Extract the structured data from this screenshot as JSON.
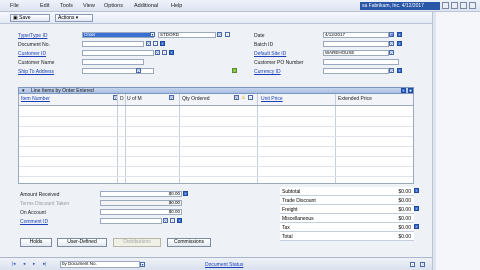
{
  "menu": [
    "File",
    "Edit",
    "Tools",
    "View",
    "Options",
    "Additional",
    "Help"
  ],
  "company": "sa  Fabrikam, Inc.  4/12/2017",
  "toolbar": {
    "save": "Save",
    "actions": "Actions"
  },
  "fields": {
    "type_type_id": "Type/Type ID",
    "type_value": "Order",
    "type_id_value": "STDORD",
    "document_no": "Document No.",
    "customer_id": "Customer ID",
    "customer_name": "Customer Name",
    "ship_to_address": "Ship To Address",
    "date": "Date",
    "date_value": "4/12/2017",
    "batch_id": "Batch ID",
    "default_site_id": "Default Site ID",
    "site_value": "WAREHOUSE",
    "customer_po": "Customer PO Number",
    "currency_id": "Currency ID"
  },
  "grid": {
    "title": "Line Items by Order Entered",
    "columns": [
      "Item Number",
      "D",
      "U of M",
      "Qty Ordered",
      "Unit Price",
      "Extended Price"
    ]
  },
  "left_totals": {
    "amount_received": "Amount Received",
    "amount_received_value": "$0.00",
    "terms_discount": "Terms Discount Taken",
    "terms_discount_value": "$0.00",
    "on_account": "On Account",
    "on_account_value": "$0.00",
    "comment_id": "Comment ID"
  },
  "totals": [
    {
      "label": "Subtotal",
      "value": "$0.00"
    },
    {
      "label": "Trade Discount",
      "value": "$0.00"
    },
    {
      "label": "Freight",
      "value": "$0.00"
    },
    {
      "label": "Miscellaneous",
      "value": "$0.00"
    },
    {
      "label": "Tax",
      "value": "$0.00"
    },
    {
      "label": "Total",
      "value": "$0.00"
    }
  ],
  "buttons": {
    "holds": "Holds",
    "user_defined": "User-Defined",
    "distributions": "Distributions",
    "commissions": "Commissions"
  },
  "status": {
    "sort": "by Document No.",
    "document_status": "Document Status"
  }
}
